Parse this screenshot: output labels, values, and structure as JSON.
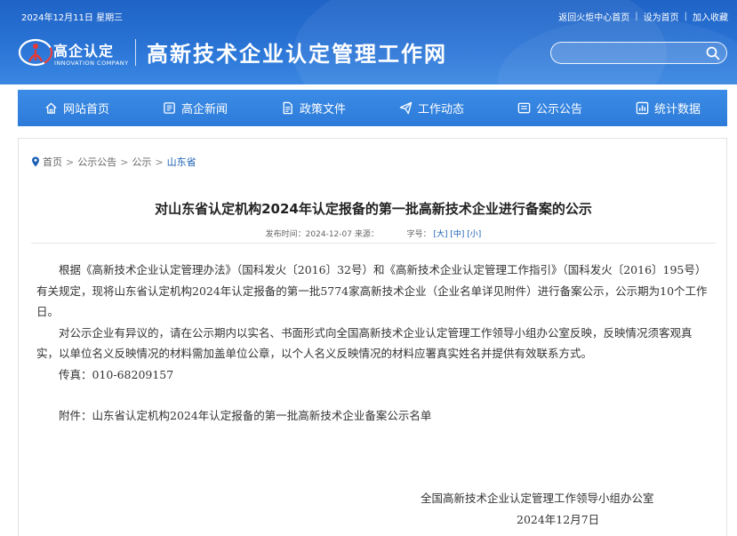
{
  "topbar": {
    "date": "2024年12月11日 星期三",
    "links": [
      "返回火炬中心首页",
      "设为首页",
      "加入收藏"
    ]
  },
  "logo": {
    "cn": "高企认定",
    "en": "INNOVATION COMPANY"
  },
  "site": {
    "title": "高新技术企业认定管理工作网"
  },
  "search": {
    "value": "",
    "icon": "search-icon"
  },
  "nav": {
    "items": [
      {
        "label": "网站首页",
        "icon": "home-icon"
      },
      {
        "label": "高企新闻",
        "icon": "news-icon"
      },
      {
        "label": "政策文件",
        "icon": "document-icon"
      },
      {
        "label": "工作动态",
        "icon": "send-icon"
      },
      {
        "label": "公示公告",
        "icon": "announcement-icon"
      },
      {
        "label": "统计数据",
        "icon": "chart-icon"
      }
    ]
  },
  "breadcrumb": {
    "items": [
      "首页",
      "公示公告",
      "公示",
      "山东省"
    ]
  },
  "article": {
    "title": "对山东省认定机构2024年认定报备的第一批高新技术企业进行备案的公示",
    "meta": {
      "published": "发布时间：2024-12-07 来源：",
      "fontsize_label": "字号：",
      "fontsize_options": [
        "[大]",
        "[中]",
        "[小]"
      ]
    },
    "paragraphs": [
      "根据《高新技术企业认定管理办法》（国科发火〔2016〕32号）和《高新技术企业认定管理工作指引》（国科发火〔2016〕195号）有关规定，现将山东省认定机构2024年认定报备的第一批5774家高新技术企业（企业名单详见附件）进行备案公示，公示期为10个工作日。",
      "对公示企业有异议的，请在公示期内以实名、书面形式向全国高新技术企业认定管理工作领导小组办公室反映，反映情况须客观真实，以单位名义反映情况的材料需加盖单位公章，以个人名义反映情况的材料应署真实姓名并提供有效联系方式。",
      "传真：010-68209157"
    ],
    "attachment": "附件：山东省认定机构2024年认定报备的第一批高新技术企业备案公示名单",
    "signature_org": "全国高新技术企业认定管理工作领导小组办公室",
    "signature_date": "2024年12月7日"
  },
  "colors": {
    "header": "#2a74d6",
    "nav": "#3385e0",
    "link": "#1a5fb4"
  }
}
